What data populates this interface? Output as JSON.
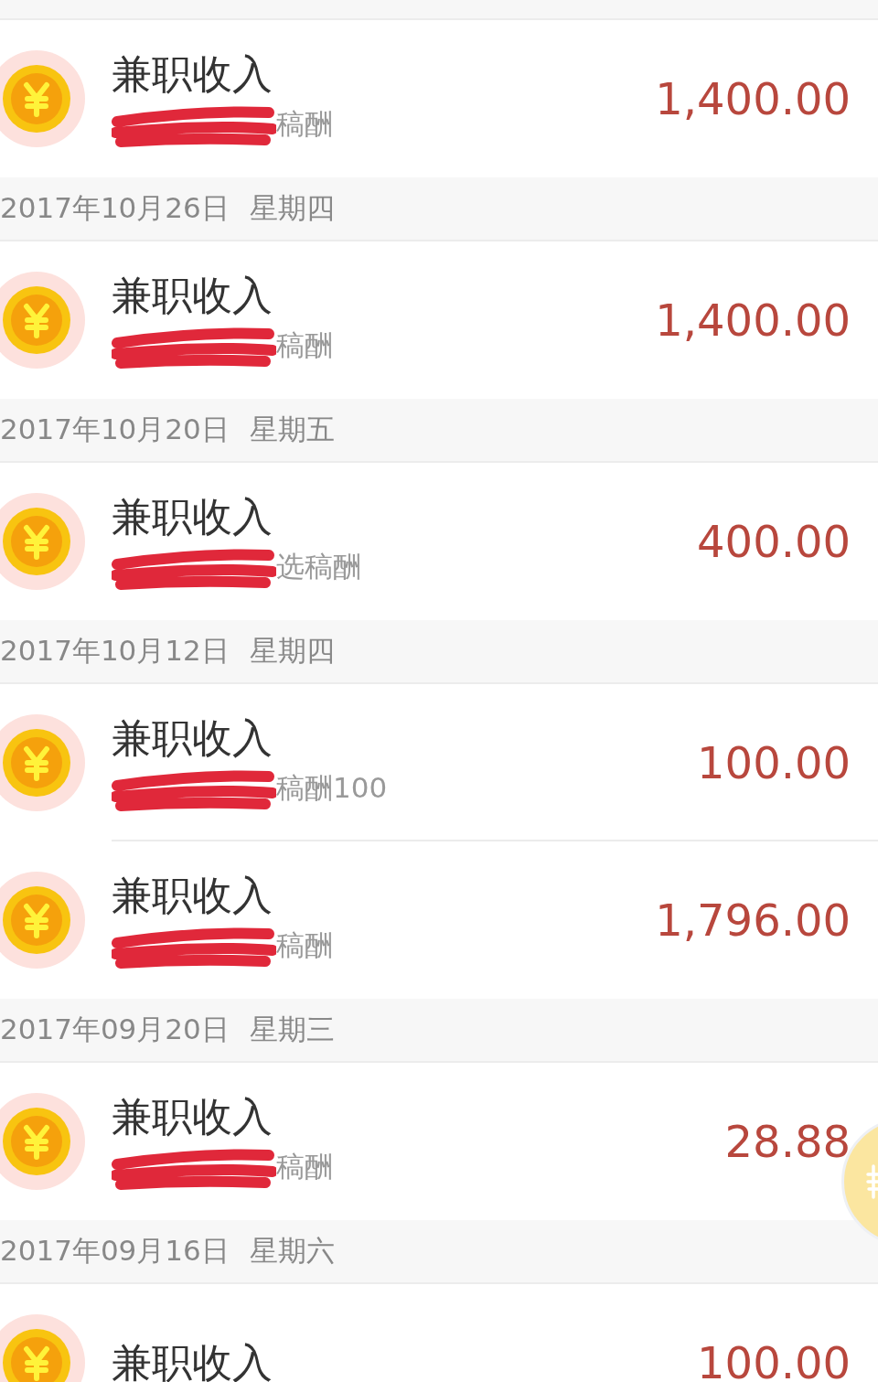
{
  "entries": [
    {
      "kind": "transaction",
      "title": "兼职收入",
      "note": "稿酬",
      "redacted": true,
      "amount": "1,400.00"
    },
    {
      "kind": "date_header",
      "date": "2017年10月26日",
      "weekday": "星期四"
    },
    {
      "kind": "transaction",
      "title": "兼职收入",
      "note": "稿酬",
      "redacted": true,
      "amount": "1,400.00"
    },
    {
      "kind": "date_header",
      "date": "2017年10月20日",
      "weekday": "星期五"
    },
    {
      "kind": "transaction",
      "title": "兼职收入",
      "note": "选稿酬",
      "redacted": true,
      "amount": "400.00"
    },
    {
      "kind": "date_header",
      "date": "2017年10月12日",
      "weekday": "星期四"
    },
    {
      "kind": "transaction",
      "title": "兼职收入",
      "note": "稿酬100",
      "redacted": true,
      "amount": "100.00"
    },
    {
      "kind": "transaction",
      "title": "兼职收入",
      "note": "稿酬",
      "redacted": true,
      "amount": "1,796.00"
    },
    {
      "kind": "date_header",
      "date": "2017年09月20日",
      "weekday": "星期三"
    },
    {
      "kind": "transaction",
      "title": "兼职收入",
      "note": "稿酬",
      "redacted": true,
      "amount": "28.88"
    },
    {
      "kind": "date_header",
      "date": "2017年09月16日",
      "weekday": "星期六"
    },
    {
      "kind": "transaction",
      "title": "兼职收入",
      "amount": "100.00"
    }
  ]
}
